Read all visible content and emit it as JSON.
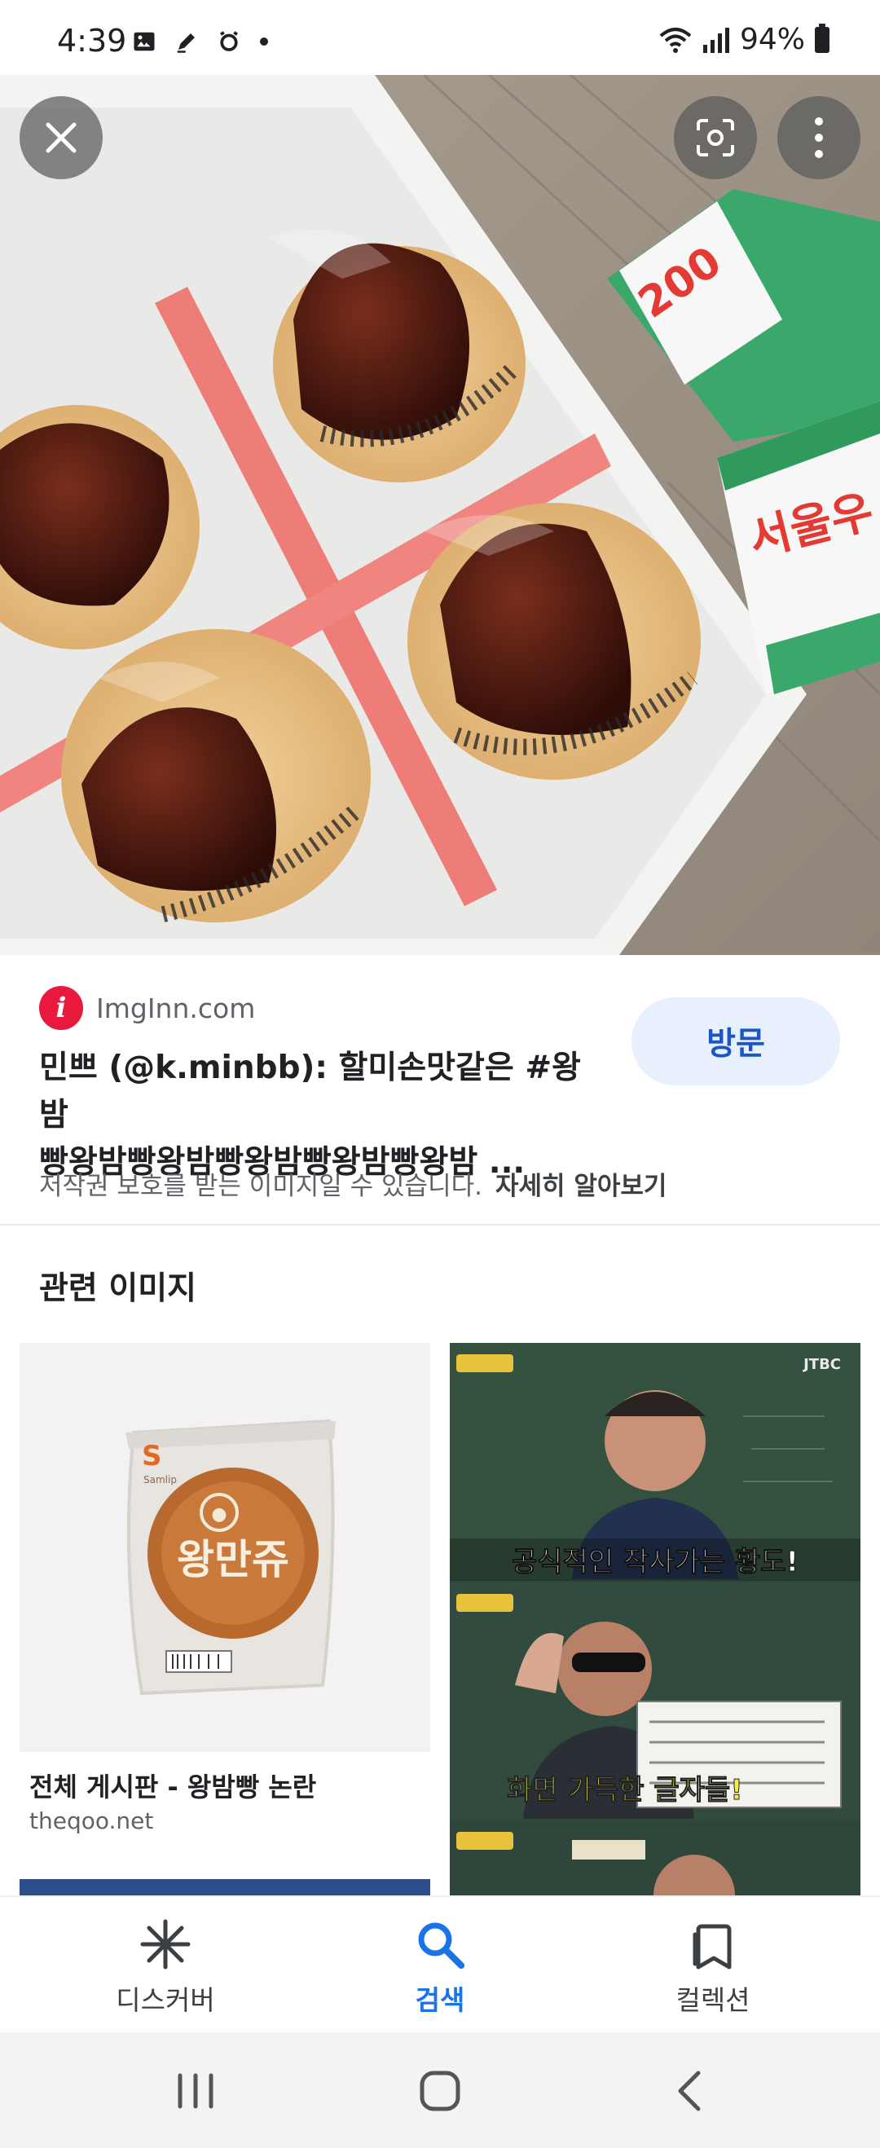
{
  "status_bar": {
    "time": "4:39",
    "battery": "94%",
    "left_icons": [
      "gallery-icon",
      "pen-icon",
      "alarm-icon",
      "dot-icon"
    ],
    "right_icons": [
      "wifi-icon",
      "signal-icon",
      "battery-icon"
    ]
  },
  "viewer": {
    "icons": [
      "close-icon",
      "lens-icon",
      "more-vert-icon"
    ],
    "hero_text": [
      "서울우",
      "200"
    ]
  },
  "source": {
    "site_badge": "i",
    "site_name": "ImgInn.com",
    "title_line1": "민쁘 (@k.minbb): 할미손맛같은 #왕밤",
    "title_line2": "빵왕밤빵왕밤빵왕밤빵왕밤빵왕밤 ...",
    "visit_label": "방문",
    "copyright_notice": "저작권 보호를 받는 이미지일 수 있습니다.",
    "learn_more": "자세히 알아보기"
  },
  "related": {
    "heading": "관련 이미지",
    "items": [
      {
        "title": "전체 게시판 - 왕밤빵 논란",
        "source": "theqoo.net",
        "image_text": [
          "왕만쥬",
          "S",
          "Samlip"
        ]
      },
      {
        "title": "",
        "source": "",
        "image_text": [
          "공식적인 작사가는 황도!",
          "화면 가득한 글자들!",
          "JTBC"
        ]
      }
    ]
  },
  "bottom_nav": {
    "items": [
      {
        "label": "디스커버",
        "icon": "asterisk-icon",
        "active": false
      },
      {
        "label": "검색",
        "icon": "search-icon",
        "active": true
      },
      {
        "label": "컬렉션",
        "icon": "bookmarks-icon",
        "active": false
      }
    ]
  },
  "colors": {
    "accent": "#1a73e8",
    "visit_button_bg": "#e8f0fe",
    "site_badge": "#e8193c"
  }
}
